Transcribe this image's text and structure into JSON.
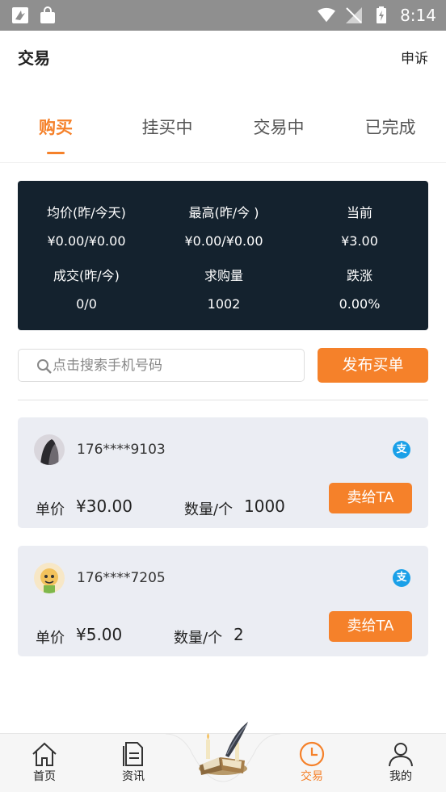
{
  "status_bar": {
    "time": "8:14"
  },
  "header": {
    "title": "交易",
    "appeal": "申诉"
  },
  "tabs": [
    {
      "label": "购买",
      "active": true
    },
    {
      "label": "挂买中",
      "active": false
    },
    {
      "label": "交易中",
      "active": false
    },
    {
      "label": "已完成",
      "active": false
    }
  ],
  "stats": {
    "avg_label": "均价(昨/今天)",
    "avg_value": "¥0.00/¥0.00",
    "high_label": "最高(昨/今 )",
    "high_value": "¥0.00/¥0.00",
    "current_label": "当前",
    "current_value": "¥3.00",
    "volume_label": "成交(昨/今)",
    "volume_value": "0/0",
    "demand_label": "求购量",
    "demand_value": "1002",
    "change_label": "跌涨",
    "change_value": "0.00%"
  },
  "search": {
    "placeholder": "点击搜索手机号码",
    "value": ""
  },
  "publish_button": "发布买单",
  "orders": [
    {
      "phone": "176****9103",
      "pay_icon": "支",
      "price_label": "单价",
      "price": "¥30.00",
      "qty_label": "数量/个",
      "qty": "1000",
      "sell_label": "卖给TA"
    },
    {
      "phone": "176****7205",
      "pay_icon": "支",
      "price_label": "单价",
      "price": "¥5.00",
      "qty_label": "数量/个",
      "qty": "2",
      "sell_label": "卖给TA"
    }
  ],
  "nav": [
    {
      "label": "首页",
      "icon": "home-icon",
      "active": false
    },
    {
      "label": "资讯",
      "icon": "document-icon",
      "active": false
    },
    {
      "label": "交易",
      "icon": "clock-icon",
      "active": true
    },
    {
      "label": "我的",
      "icon": "user-icon",
      "active": false
    }
  ],
  "colors": {
    "accent": "#f5812a",
    "stats_bg": "#14222e",
    "card_bg": "#ebedf3",
    "alipay": "#1aa0e8"
  }
}
